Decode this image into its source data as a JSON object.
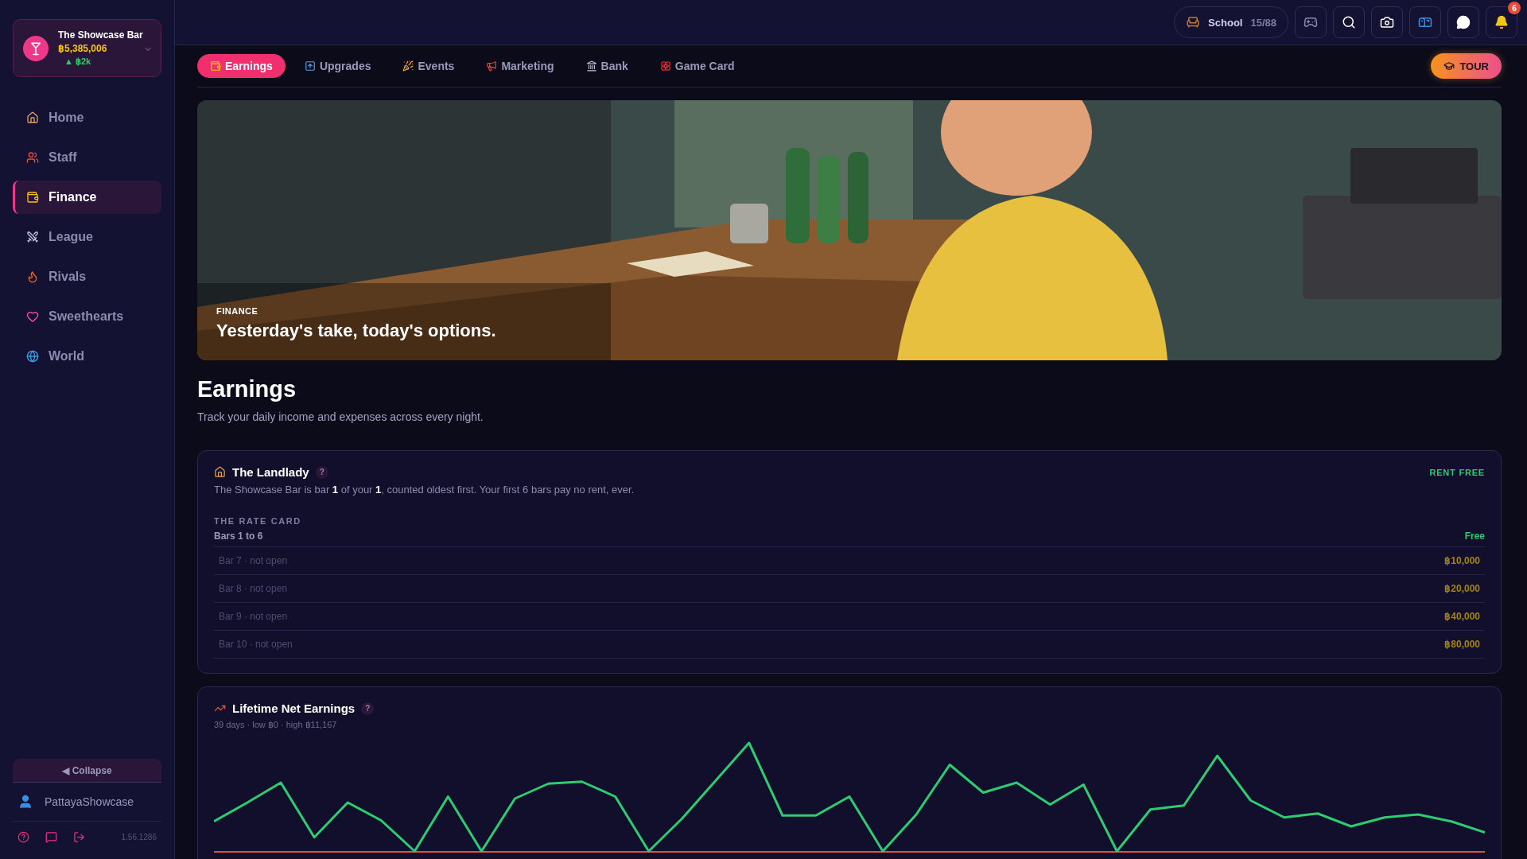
{
  "brand": {
    "name": "The Showcase Bar",
    "balance": "฿5,385,006",
    "change": "▲ ฿2k"
  },
  "nav": [
    {
      "label": "Home",
      "selected": false
    },
    {
      "label": "Staff",
      "selected": false
    },
    {
      "label": "Finance",
      "selected": true
    },
    {
      "label": "League",
      "selected": false
    },
    {
      "label": "Rivals",
      "selected": false
    },
    {
      "label": "Sweethearts",
      "selected": false
    },
    {
      "label": "World",
      "selected": false
    }
  ],
  "collapse": "◀ Collapse",
  "user": "PattayaShowcase",
  "version": "1.56.1286",
  "topbar": {
    "location": "School",
    "capacity": "15/88",
    "notifications": "6"
  },
  "tabs": [
    {
      "label": "Earnings",
      "selected": true
    },
    {
      "label": "Upgrades",
      "selected": false
    },
    {
      "label": "Events",
      "selected": false
    },
    {
      "label": "Marketing",
      "selected": false
    },
    {
      "label": "Bank",
      "selected": false
    },
    {
      "label": "Game Card",
      "selected": false
    }
  ],
  "tour": "TOUR",
  "hero": {
    "eyebrow": "FINANCE",
    "headline": "Yesterday's take, today's options."
  },
  "page": {
    "title": "Earnings",
    "subtitle": "Track your daily income and expenses across every night."
  },
  "landlady": {
    "title": "The Landlady",
    "help": "?",
    "status": "RENT FREE",
    "text": "The Showcase Bar is bar **1** of your **1**, counted oldest first. Your first 6 bars pay no rent, ever.",
    "rate_title": "THE RATE CARD",
    "rates": [
      {
        "label": "Bars 1 to 6",
        "price": "Free",
        "dimmed": false
      },
      {
        "label": "Bar 7 · not open",
        "price": "฿10,000",
        "dimmed": true
      },
      {
        "label": "Bar 8 · not open",
        "price": "฿20,000",
        "dimmed": true
      },
      {
        "label": "Bar 9 · not open",
        "price": "฿40,000",
        "dimmed": true
      },
      {
        "label": "Bar 10 · not open",
        "price": "฿80,000",
        "dimmed": true
      }
    ]
  },
  "earnings_chart": {
    "title": "Lifetime Net Earnings",
    "help": "?",
    "summary": "39 days · low ฿0 · high ฿11,167"
  }
}
